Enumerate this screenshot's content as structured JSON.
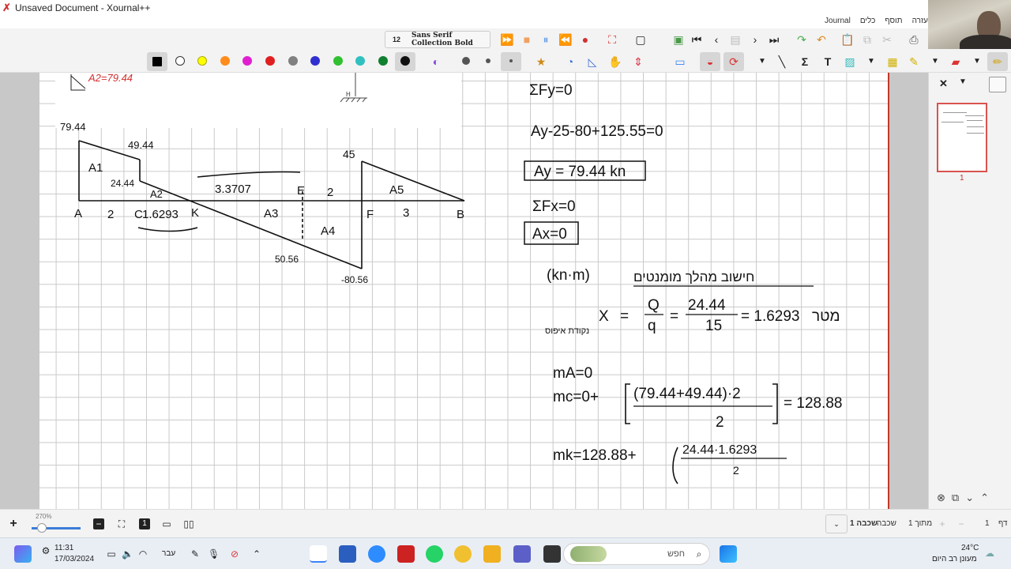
{
  "window": {
    "title": "Unsaved Document - Xournal++"
  },
  "menu": {
    "items": [
      "עזרה",
      "תוסף",
      "כלים",
      "Journal"
    ]
  },
  "toolbar": {
    "font_size": "12",
    "font_name": "Sans Serif Collection Bold",
    "colors": [
      "#000000",
      "#ffffff",
      "#ffff00",
      "#ff8c1a",
      "#e020d0",
      "#e02020",
      "#808080",
      "#3030d0",
      "#30c030",
      "#30c0c0",
      "#108030",
      "#101010"
    ]
  },
  "notes": {
    "top_label": "A2=79.44",
    "left_values": {
      "v_a": "79.44",
      "v_top": "49.44",
      "v_mid": "24.44",
      "v_e": "45",
      "v_low1": "50.56",
      "v_low2": "-80.56",
      "a1": "A1",
      "a2": "A2",
      "a3": "A3",
      "a4": "A4",
      "a5": "A5",
      "pa": "A",
      "pc": "C",
      "pk": "K",
      "pe": "E",
      "pf": "F",
      "pb": "B",
      "d1": "2",
      "d2": "1.6293",
      "d3": "3.3707",
      "d4": "2",
      "d5": "3",
      "support": "H"
    },
    "right_lines": {
      "sum_fy": "ΣFy=0",
      "eq_fy": "Ay-25-80+125.55=0",
      "ay": "Ay = 79.44 kn",
      "sum_fx": "ΣFx=0",
      "ax": "Ax=0",
      "unit": "(kn·m)",
      "heading": "חישוב מהלך מומנטים",
      "zero_point": "נקודת איפוס",
      "x_lhs": "X",
      "frac_q": "Q",
      "frac_lower_q": "q",
      "frac_num": "24.44",
      "frac_den": "15",
      "x_result": "= 1.6293",
      "meter": "מטר",
      "ma": "mA=0",
      "mc_lhs": "mc=0+",
      "mc_num": "(79.44+49.44)·2",
      "mc_den": "2",
      "mc_result": "= 128.88",
      "mk_lhs": "mk=128.88+",
      "mk_num": "24.44·1.6293",
      "mk_den": "2"
    }
  },
  "sidebar": {
    "page_number": "1"
  },
  "statusbar": {
    "zoom": "270%",
    "page_label": "דף",
    "page_value": "1",
    "of_label": "מתוך 1",
    "layer_label": "שכבה",
    "layer_value": "שכבה 1"
  },
  "taskbar": {
    "time": "11:31",
    "date": "17/03/2024",
    "lang": "עבר",
    "search": "חפש",
    "weather_temp": "24°C",
    "weather_desc": "מעונן רב היום"
  }
}
